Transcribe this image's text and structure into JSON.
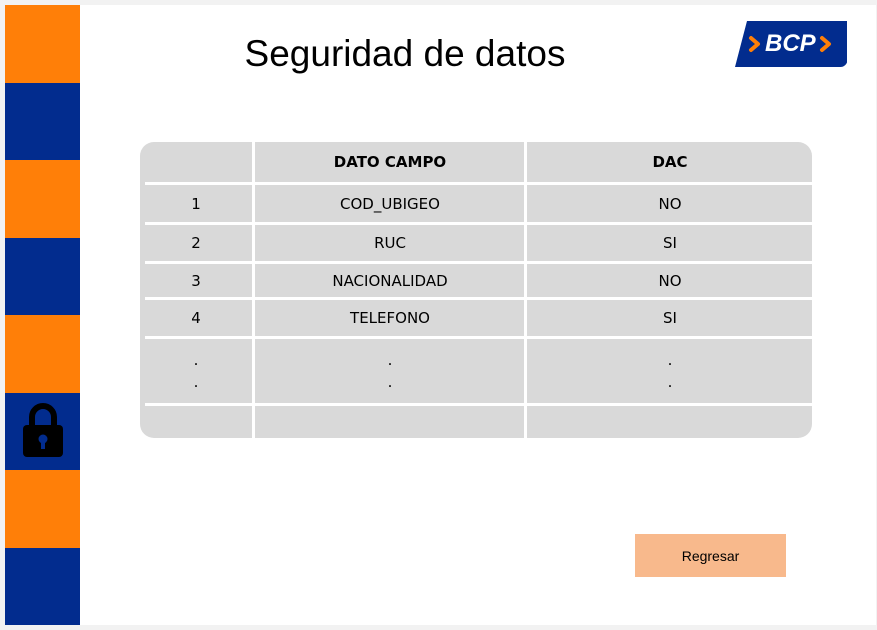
{
  "page": {
    "title": "Seguridad de datos"
  },
  "logo": {
    "text": "BCP"
  },
  "colors": {
    "orange": "#ff7f08",
    "blue": "#022c8e",
    "button": "#f8b98c",
    "table_bg": "#d9d9d9"
  },
  "table": {
    "headers": [
      "",
      "DATO CAMPO",
      "DAC"
    ],
    "rows": [
      [
        "1",
        "COD_UBIGEO",
        "NO"
      ],
      [
        "2",
        "RUC",
        "SI"
      ],
      [
        "3",
        "NACIONALIDAD",
        "NO"
      ],
      [
        "4",
        "TELEFONO",
        "SI"
      ]
    ],
    "ellipsis": "."
  },
  "button": {
    "label": "Regresar"
  },
  "icons": {
    "sidebar": "lock-icon",
    "logo_arrows": "chevron-right-icon"
  }
}
